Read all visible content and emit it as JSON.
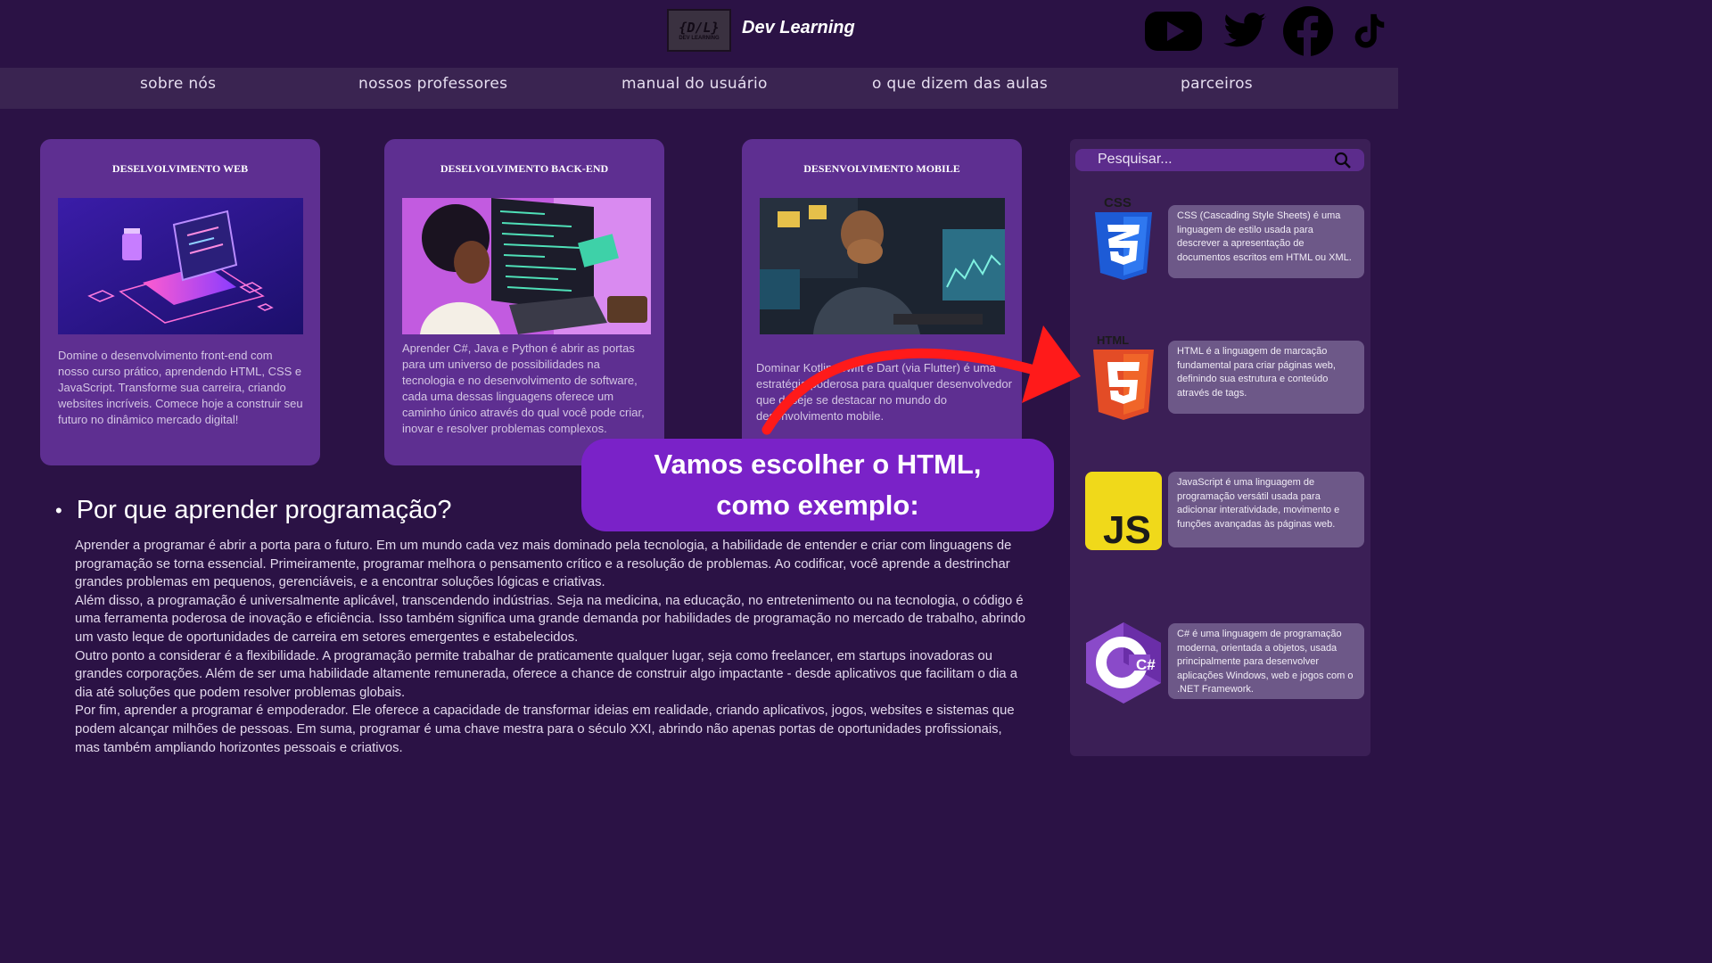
{
  "header": {
    "logo_text": "{D/L}",
    "logo_subtext": "DEV LEARNING",
    "brand": "Dev Learning",
    "social_icons": [
      "youtube-icon",
      "twitter-icon",
      "facebook-icon",
      "tiktok-icon"
    ]
  },
  "nav": {
    "items": [
      {
        "label": "sobre nós"
      },
      {
        "label": "nossos professores"
      },
      {
        "label": "manual do usuário"
      },
      {
        "label": "o que dizem das aulas"
      },
      {
        "label": "parceiros"
      }
    ]
  },
  "cards": [
    {
      "title": "DESELVOLVIMENTO WEB",
      "text": "Domine o desenvolvimento front-end com nosso curso prático, aprendendo HTML, CSS e JavaScript. Transforme sua carreira, criando websites incríveis. Comece hoje a construir seu futuro no dinâmico mercado digital!"
    },
    {
      "title": "DESELVOLVIMENTO BACK-END",
      "text": "Aprender C#, Java e Python é abrir as portas para um universo de possibilidades na tecnologia e no desenvolvimento de software, cada uma dessas linguagens oferece um caminho único através do qual você pode criar, inovar e resolver problemas complexos."
    },
    {
      "title": "DESENVOLVIMENTO MOBILE",
      "text": "Dominar Kotlin, Swift e Dart (via Flutter) é uma estratégia poderosa para qualquer desenvolvedor que deseje se destacar no mundo do desenvolvimento mobile."
    }
  ],
  "section": {
    "heading": "Por que aprender programação?",
    "paragraphs": [
      "Aprender a programar é abrir a porta para o futuro. Em um mundo cada vez mais dominado pela tecnologia, a habilidade de entender e criar com linguagens de programação se torna essencial. Primeiramente, programar melhora o pensamento crítico e a resolução de problemas. Ao codificar, você aprende a destrinchar grandes problemas em pequenos, gerenciáveis, e a encontrar soluções lógicas e criativas.",
      "Além disso, a programação é universalmente aplicável, transcendendo indústrias. Seja na medicina, na educação, no entretenimento ou na tecnologia, o código é uma ferramenta poderosa de inovação e eficiência. Isso também significa uma grande demanda por habilidades de programação no mercado de trabalho, abrindo um vasto leque de oportunidades de carreira em setores emergentes e estabelecidos.",
      "Outro ponto a considerar é a flexibilidade. A programação permite trabalhar de praticamente qualquer lugar, seja como freelancer, em startups inovadoras ou grandes corporações. Além de ser uma habilidade altamente remunerada, oferece a chance de construir algo impactante - desde aplicativos que facilitam o dia a dia até soluções que podem resolver problemas globais.",
      "Por fim, aprender a programar é empoderador. Ele oferece a capacidade de transformar ideias em realidade, criando aplicativos, jogos, websites e sistemas que podem alcançar milhões de pessoas. Em suma, programar é uma chave mestra para o século XXI, abrindo não apenas portas de oportunidades profissionais, mas também ampliando horizontes pessoais e criativos."
    ]
  },
  "callout": {
    "line1": "Vamos escolher o HTML,",
    "line2": "como exemplo:"
  },
  "sidebar": {
    "search_placeholder": "Pesquisar...",
    "languages": [
      {
        "icon_label": "CSS",
        "desc": "CSS (Cascading Style Sheets) é uma linguagem de estilo usada para descrever a apresentação de documentos escritos em HTML ou XML."
      },
      {
        "icon_label": "HTML",
        "desc": "HTML é a linguagem de marcação fundamental para criar páginas web, definindo sua estrutura e conteúdo através de tags."
      },
      {
        "icon_label": "JS",
        "desc": "JavaScript é uma linguagem de programação versátil usada para adicionar interatividade, movimento e funções avançadas às páginas web."
      },
      {
        "icon_label": "C#",
        "desc": "C# é uma linguagem de programação moderna, orientada a objetos, usada principalmente para desenvolver aplicações Windows, web e jogos com o .NET Framework."
      }
    ]
  },
  "colors": {
    "background": "#2b1245",
    "nav_bar": "#3a2451",
    "card": "#5e2f91",
    "callout": "#7a22c8",
    "arrow": "#ff1a1a",
    "sidebar": "#3b1f56"
  }
}
